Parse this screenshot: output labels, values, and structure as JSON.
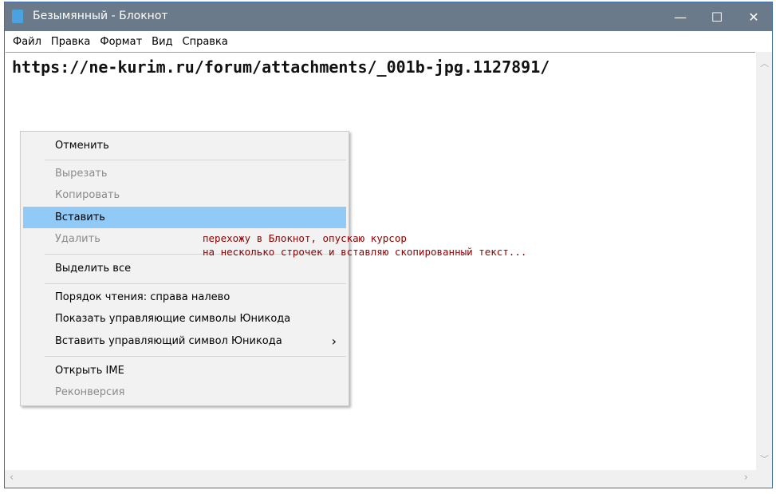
{
  "window": {
    "title": "Безымянный - Блокнот",
    "minimize": "—",
    "maximize": "☐",
    "close": "✕"
  },
  "menu": [
    "Файл",
    "Правка",
    "Формат",
    "Вид",
    "Справка"
  ],
  "editor": {
    "text": "https://ne-kurim.ru/forum/attachments/_001b-jpg.1127891/"
  },
  "context_menu": {
    "items": [
      {
        "label": "Отменить",
        "disabled": false
      },
      {
        "label": "Вырезать",
        "disabled": true
      },
      {
        "label": "Копировать",
        "disabled": true
      },
      {
        "label": "Вставить",
        "disabled": false,
        "highlighted": true
      },
      {
        "label": "Удалить",
        "disabled": true
      },
      {
        "label": "Выделить все",
        "disabled": false
      },
      {
        "label": "Порядок чтения: справа налево",
        "disabled": false
      },
      {
        "label": "Показать управляющие символы Юникода",
        "disabled": false
      },
      {
        "label": "Вставить управляющий символ Юникода",
        "disabled": false,
        "submenu": "›"
      },
      {
        "label": "Открыть IME",
        "disabled": false
      },
      {
        "label": "Реконверсия",
        "disabled": true
      }
    ]
  },
  "annotation": {
    "line1": "перехожу в Блокнот, опускаю курсор",
    "line2": "на несколько строчек и вставляю скопированный текст..."
  }
}
